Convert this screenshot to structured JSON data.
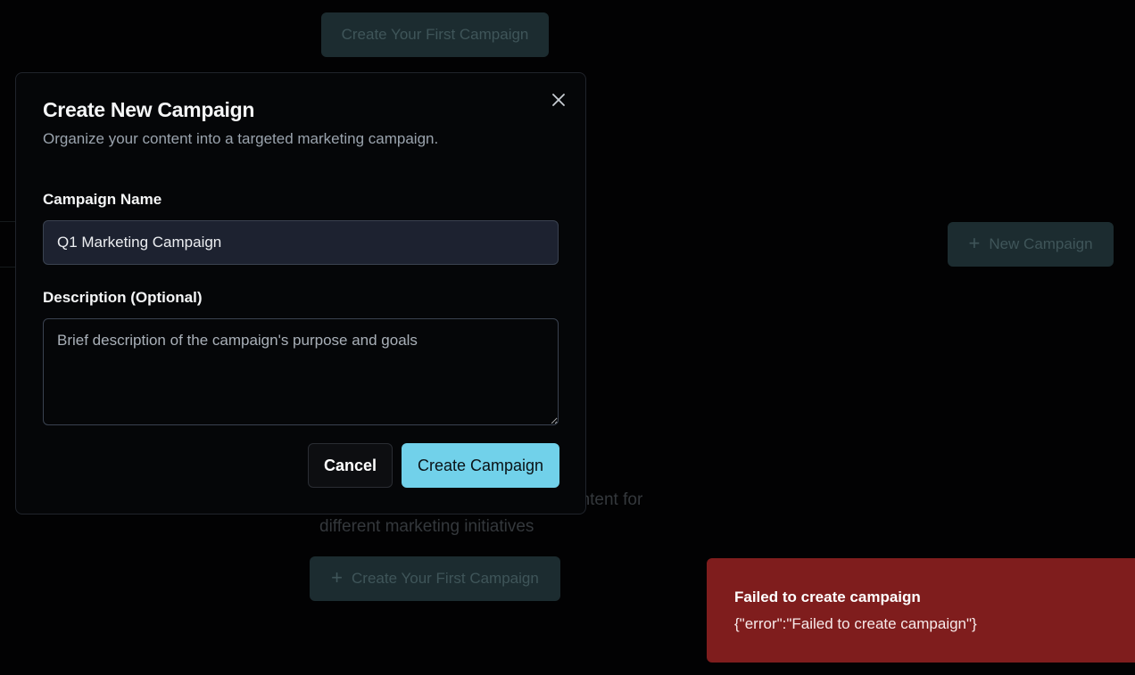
{
  "background": {
    "top_button_label": "Create Your First Campaign",
    "new_campaign_label": "New Campaign",
    "empty_state_text_line1": "ontent for",
    "empty_state_text_line2": "different marketing initiatives",
    "bottom_button_label": "Create Your First Campaign",
    "plus_icon": "+"
  },
  "modal": {
    "title": "Create New Campaign",
    "subtitle": "Organize your content into a targeted marketing campaign.",
    "close_icon": "close-icon",
    "campaign_name_label": "Campaign Name",
    "campaign_name_value": "Q1 Marketing Campaign",
    "description_label": "Description (Optional)",
    "description_placeholder": "Brief description of the campaign's purpose and goals",
    "description_value": "",
    "cancel_label": "Cancel",
    "create_label": "Create Campaign"
  },
  "toast": {
    "title": "Failed to create campaign",
    "message": "{\"error\":\"Failed to create campaign\"}"
  },
  "colors": {
    "accent": "#71d1ea",
    "error": "#7f1d1d"
  }
}
